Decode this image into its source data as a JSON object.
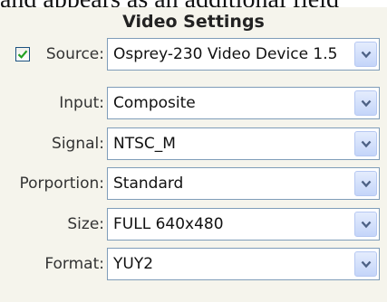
{
  "background_text": "and appears as an additional field",
  "panel": {
    "title": "Video Settings"
  },
  "fields": {
    "source": {
      "label": "Source:",
      "value": "Osprey-230 Video Device 1.5",
      "checked": true
    },
    "input": {
      "label": "Input:",
      "value": "Composite"
    },
    "signal": {
      "label": "Signal:",
      "value": "NTSC_M"
    },
    "proportion": {
      "label": "Porportion:",
      "value": "Standard"
    },
    "size": {
      "label": "Size:",
      "value": "FULL 640x480"
    },
    "format": {
      "label": "Format:",
      "value": "YUY2"
    }
  },
  "icons": {
    "checkbox_check": "checkmark-icon",
    "dropdown_arrow": "chevron-down-icon"
  },
  "colors": {
    "panel_background": "#f5f4ec",
    "field_border": "#7f9db9",
    "checkmark": "#21a121",
    "arrow": "#4d6185"
  }
}
